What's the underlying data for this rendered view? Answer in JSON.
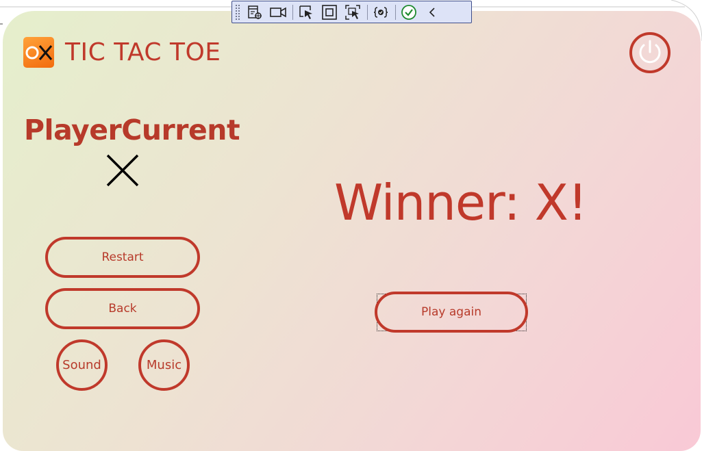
{
  "app": {
    "title": "TIC TAC TOE",
    "logo_icon": "ox-logo-icon"
  },
  "player": {
    "label": "PlayerCurrent",
    "mark": "X"
  },
  "game": {
    "winner_text": "Winner: X!"
  },
  "buttons": {
    "restart": "Restart",
    "back": "Back",
    "sound": "Sound",
    "music": "Music",
    "play_again": "Play again"
  },
  "dev_toolbar": {
    "icons": [
      "live-visual-tree-icon",
      "record-icon",
      "select-element-icon",
      "display-layout-adorners-icon",
      "track-focused-element-icon",
      "binding-failures-icon",
      "hot-reload-ok-icon",
      "collapse-icon"
    ]
  },
  "colors": {
    "accent": "#c0392b",
    "logo_orange": "#f7841c",
    "gradient_start": "#e5efcc",
    "gradient_end": "#f9c9d6"
  }
}
